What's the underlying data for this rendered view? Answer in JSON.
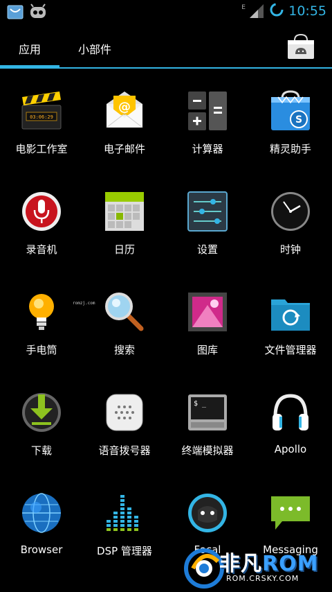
{
  "status_bar": {
    "time": "10:55",
    "network_type": "E",
    "icons": [
      "store-notification-icon",
      "android-notification-icon",
      "signal-icon",
      "loading-icon"
    ]
  },
  "tabs": {
    "apps": "应用",
    "widgets": "小部件"
  },
  "apps": [
    {
      "label": "电影工作室",
      "icon": "movie-studio-icon"
    },
    {
      "label": "电子邮件",
      "icon": "email-icon"
    },
    {
      "label": "计算器",
      "icon": "calculator-icon"
    },
    {
      "label": "精灵助手",
      "icon": "assistant-bag-icon"
    },
    {
      "label": "录音机",
      "icon": "recorder-mic-icon"
    },
    {
      "label": "日历",
      "icon": "calendar-icon"
    },
    {
      "label": "设置",
      "icon": "settings-sliders-icon"
    },
    {
      "label": "时钟",
      "icon": "clock-icon"
    },
    {
      "label": "手电筒",
      "icon": "flashlight-bulb-icon"
    },
    {
      "label": "搜索",
      "icon": "search-magnifier-icon"
    },
    {
      "label": "图库",
      "icon": "gallery-icon"
    },
    {
      "label": "文件管理器",
      "icon": "file-manager-icon"
    },
    {
      "label": "下载",
      "icon": "download-icon"
    },
    {
      "label": "语音拨号器",
      "icon": "voice-dialer-icon"
    },
    {
      "label": "终端模拟器",
      "icon": "terminal-icon"
    },
    {
      "label": "Apollo",
      "icon": "headphones-icon"
    },
    {
      "label": "Browser",
      "icon": "globe-icon"
    },
    {
      "label": "DSP 管理器",
      "icon": "equalizer-icon"
    },
    {
      "label": "Focal",
      "icon": "focal-camera-icon"
    },
    {
      "label": "Messaging",
      "icon": "messaging-icon"
    }
  ],
  "watermarks": {
    "small": "romzj.com",
    "brand_cn": "非凡",
    "brand_rom": "ROM",
    "brand_url": "ROM.CRSKY.COM"
  },
  "colors": {
    "accent": "#33b5e5",
    "background": "#000000"
  }
}
